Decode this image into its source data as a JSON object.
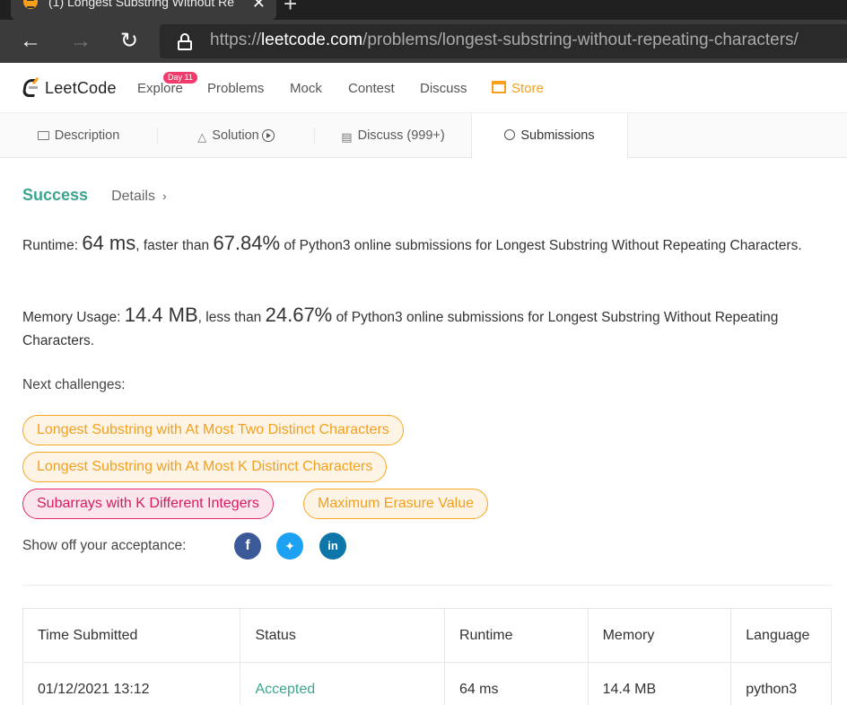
{
  "browser": {
    "tab_title": "(1) Longest Substring Without Re",
    "tab_close": "✕",
    "new_tab": "+",
    "url_scheme": "https://",
    "url_host": "leetcode.com",
    "url_path": "/problems/longest-substring-without-repeating-characters/",
    "back_icon": "arrow-left",
    "forward_icon": "arrow-right",
    "reload_icon": "reload"
  },
  "header": {
    "logo_text": "LeetCode",
    "menu": [
      "Explore",
      "Problems",
      "Mock",
      "Contest",
      "Discuss",
      "Store"
    ],
    "explore_badge": "Day 11"
  },
  "tabs": {
    "description": "Description",
    "solution": "Solution",
    "discuss": "Discuss (999+)",
    "submissions": "Submissions"
  },
  "result": {
    "status": "Success",
    "details": "Details",
    "runtime_label": "Runtime:",
    "runtime_value": "64 ms",
    "runtime_mid": ", faster than",
    "runtime_pct": "67.84%",
    "runtime_tail": "of Python3 online submissions for Longest Substring Without Repeating Characters.",
    "memory_label": "Memory Usage:",
    "memory_value": "14.4 MB",
    "memory_mid": ", less than",
    "memory_pct": "24.67%",
    "memory_tail": "of Python3 online submissions for Longest Substring Without Repeating Characters."
  },
  "next_challenges": {
    "label": "Next challenges:",
    "items": [
      {
        "title": "Longest Substring with At Most Two Distinct Characters",
        "difficulty": "medium"
      },
      {
        "title": "Longest Substring with At Most K Distinct Characters",
        "difficulty": "medium"
      },
      {
        "title": "Subarrays with K Different Integers",
        "difficulty": "hard"
      },
      {
        "title": "Maximum Erasure Value",
        "difficulty": "medium"
      }
    ]
  },
  "share": {
    "label": "Show off your acceptance:",
    "icons": [
      "facebook-icon",
      "twitter-icon",
      "linkedin-icon"
    ]
  },
  "submissions_table": {
    "headers": [
      "Time Submitted",
      "Status",
      "Runtime",
      "Memory",
      "Language"
    ],
    "rows": [
      [
        "01/12/2021 13:12",
        "Accepted",
        "64 ms",
        "14.4 MB",
        "python3"
      ]
    ]
  },
  "colors": {
    "success": "#3da58f",
    "medium": "#f0a020",
    "hard": "#d81b60",
    "store": "#f89f1b"
  }
}
